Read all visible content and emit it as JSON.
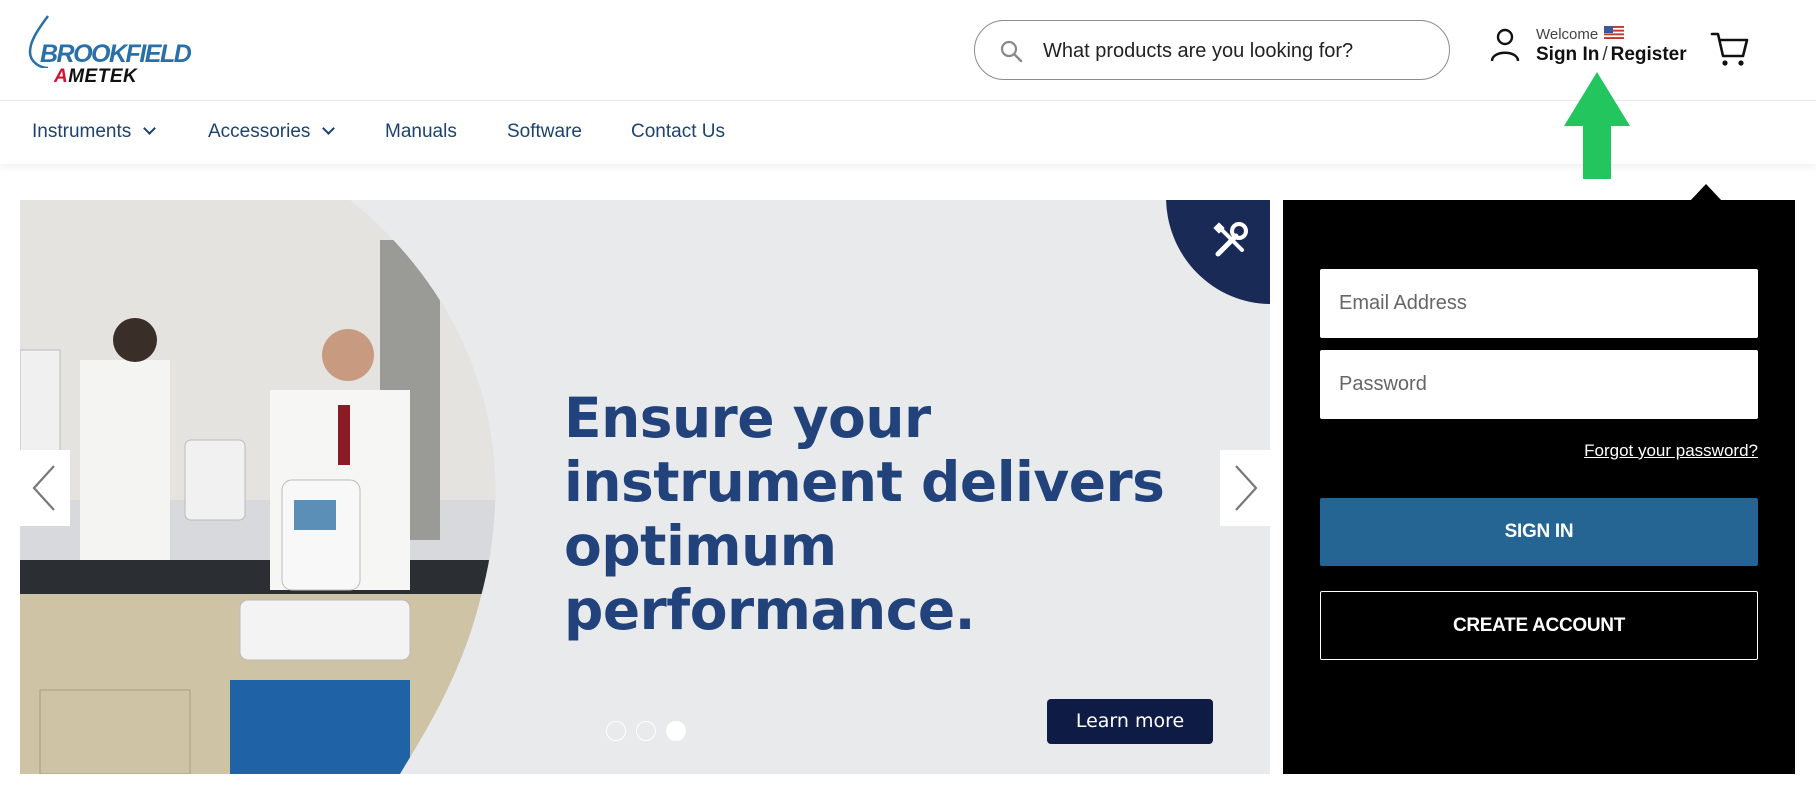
{
  "logo": {
    "brand": "BROOKFIELD",
    "company_prefix": "A",
    "company_rest": "METEK"
  },
  "search": {
    "placeholder": "What products are you looking for?"
  },
  "account": {
    "welcome": "Welcome",
    "sign_in": "Sign In",
    "separator": "/",
    "register": "Register"
  },
  "nav": {
    "items": [
      {
        "label": "Instruments",
        "has_dropdown": true
      },
      {
        "label": "Accessories",
        "has_dropdown": true
      },
      {
        "label": "Manuals",
        "has_dropdown": false
      },
      {
        "label": "Software",
        "has_dropdown": false
      },
      {
        "label": "Contact Us",
        "has_dropdown": false
      }
    ]
  },
  "hero": {
    "title": "Ensure your instrument delivers optimum performance.",
    "cta": "Learn more",
    "slides": 3,
    "active_slide": 3
  },
  "login": {
    "email_placeholder": "Email Address",
    "password_placeholder": "Password",
    "forgot": "Forgot your password?",
    "sign_in_button": "SIGN IN",
    "create_account_button": "CREATE ACCOUNT"
  },
  "colors": {
    "brand_navy": "#21427a",
    "nav_text": "#1c4270",
    "sign_in_blue": "#246594",
    "cta_navy": "#0e1c45",
    "annotation_green": "#22c55e"
  }
}
